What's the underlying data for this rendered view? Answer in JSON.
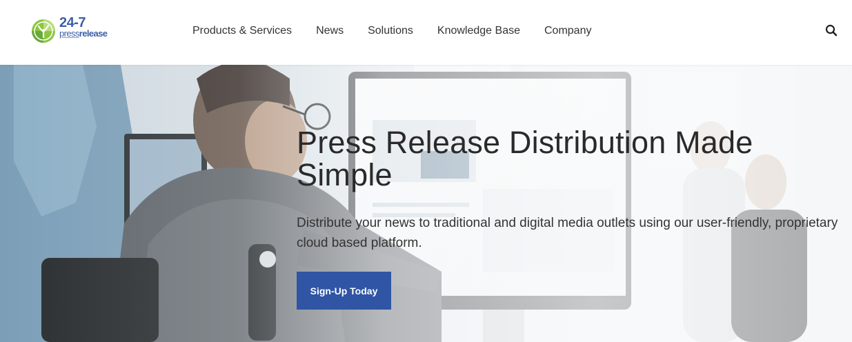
{
  "logo": {
    "top_text": "24-7",
    "press_text": "press",
    "release_text": "release",
    "icon": "247-pressrelease-logo-icon"
  },
  "nav": {
    "items": [
      {
        "label": "Products & Services"
      },
      {
        "label": "News"
      },
      {
        "label": "Solutions"
      },
      {
        "label": "Knowledge Base"
      },
      {
        "label": "Company"
      }
    ],
    "search_icon": "search-icon"
  },
  "hero": {
    "title": "Press Release Distribution Made Simple",
    "subtitle": "Distribute your news to traditional and digital media outlets using our user-friendly, proprietary cloud based platform.",
    "cta_label": "Sign-Up Today",
    "background": "office-workers-at-computer-photo"
  },
  "colors": {
    "brand_blue": "#3b5ea8",
    "brand_green": "#7cb83f",
    "button_blue": "#2f55a4",
    "text_dark": "#2a2a2a"
  }
}
